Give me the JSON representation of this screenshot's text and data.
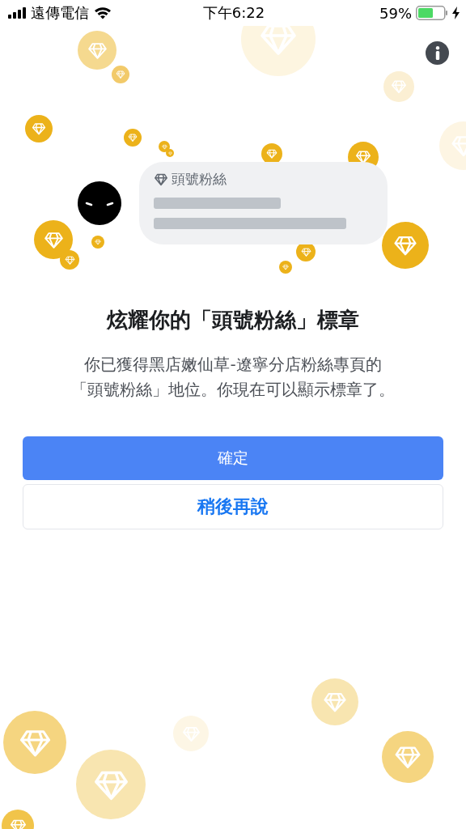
{
  "status_bar": {
    "carrier": "遠傳電信",
    "time": "下午6:22",
    "battery": "59%"
  },
  "preview_card": {
    "label": "頭號粉絲"
  },
  "title": "炫耀你的「頭號粉絲」標章",
  "message": [
    "你已獲得黑店嫩仙草-遼寧分店粉絲專頁的",
    "「頭號粉絲」地位。你現在可以顯示標章了。"
  ],
  "buttons": [
    {
      "label": "確定",
      "kind": "primary"
    },
    {
      "label": "稍後再說",
      "kind": "secondary"
    }
  ]
}
